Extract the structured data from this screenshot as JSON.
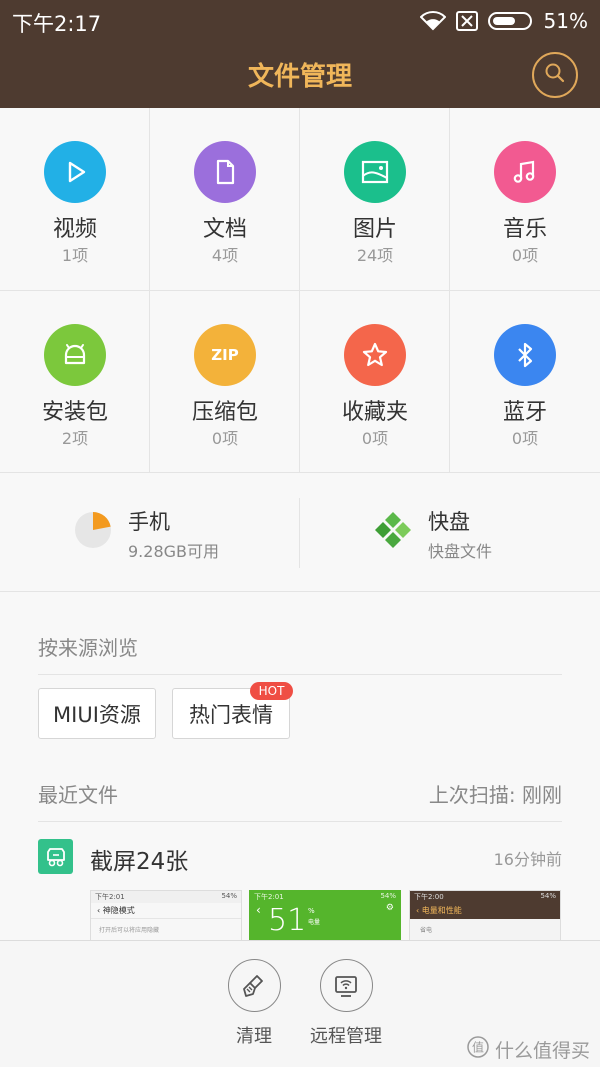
{
  "status": {
    "time": "下午2:17",
    "battery": "51%"
  },
  "app": {
    "title": "文件管理"
  },
  "categories": [
    {
      "label": "视频",
      "count": "1项",
      "color": "#22b0e6",
      "icon": "play-icon"
    },
    {
      "label": "文档",
      "count": "4项",
      "color": "#9b6fdc",
      "icon": "document-icon"
    },
    {
      "label": "图片",
      "count": "24项",
      "color": "#1bbf8c",
      "icon": "image-icon"
    },
    {
      "label": "音乐",
      "count": "0项",
      "color": "#f25a91",
      "icon": "music-icon"
    },
    {
      "label": "安装包",
      "count": "2项",
      "color": "#7cc83c",
      "icon": "android-icon"
    },
    {
      "label": "压缩包",
      "count": "0项",
      "color": "#f3b23a",
      "icon": "zip-icon",
      "icon_text": "ZIP"
    },
    {
      "label": "收藏夹",
      "count": "0项",
      "color": "#f4664b",
      "icon": "star-icon"
    },
    {
      "label": "蓝牙",
      "count": "0项",
      "color": "#3b86f0",
      "icon": "bluetooth-icon"
    }
  ],
  "storage": {
    "phone": {
      "name": "手机",
      "sub": "9.28GB可用",
      "icon": "pie-storage-icon",
      "used_fraction": 0.22
    },
    "kuaipan": {
      "name": "快盘",
      "sub": "快盘文件",
      "icon": "kuaipan-icon"
    }
  },
  "sources": {
    "title": "按来源浏览",
    "buttons": [
      {
        "label": "MIUI资源"
      },
      {
        "label": "热门表情",
        "badge": "HOT"
      }
    ]
  },
  "recent": {
    "title": "最近文件",
    "scan_status": "上次扫描: 刚刚",
    "group": {
      "name": "截屏24张",
      "time": "16分钟前"
    },
    "thumbs": [
      {
        "time": "下午2:01",
        "battery": "54%",
        "title": "神隐模式",
        "body": "打开后可以将应用隐藏"
      },
      {
        "time": "下午2:01",
        "battery": "54%",
        "big": "51",
        "unit": "%",
        "unit_sub": "电量"
      },
      {
        "time": "下午2:00",
        "battery": "54%",
        "title": "电量和性能",
        "body": "省电"
      }
    ]
  },
  "bottom_bar": {
    "clean": "清理",
    "remote": "远程管理"
  },
  "watermark": {
    "text": "什么值得买"
  }
}
